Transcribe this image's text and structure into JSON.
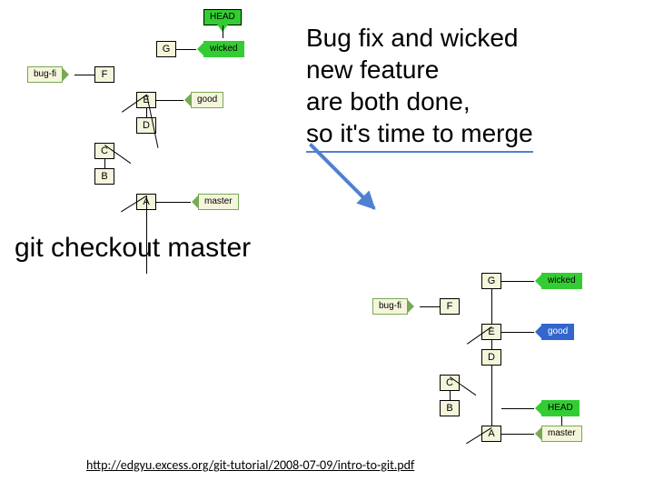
{
  "title": {
    "line1": "Bug fix and wicked",
    "line2": "new feature",
    "line3": "are both done,",
    "line4": "so it's time to merge"
  },
  "command": "git checkout master",
  "footer_url": "http://edgyu.excess.org/git-tutorial/2008-07-09/intro-to-git.pdf",
  "diagram1": {
    "head": "HEAD",
    "commits": [
      "A",
      "B",
      "C",
      "D",
      "E",
      "F",
      "G"
    ],
    "refs": {
      "wicked": "wicked",
      "good": "good",
      "bugfi": "bug-fi",
      "master": "master"
    }
  },
  "diagram2": {
    "commits": [
      "A",
      "B",
      "C",
      "D",
      "E",
      "F",
      "G"
    ],
    "refs": {
      "wicked": "wicked",
      "good": "good",
      "bugfi": "bug-fi",
      "master": "master",
      "head": "HEAD"
    }
  }
}
